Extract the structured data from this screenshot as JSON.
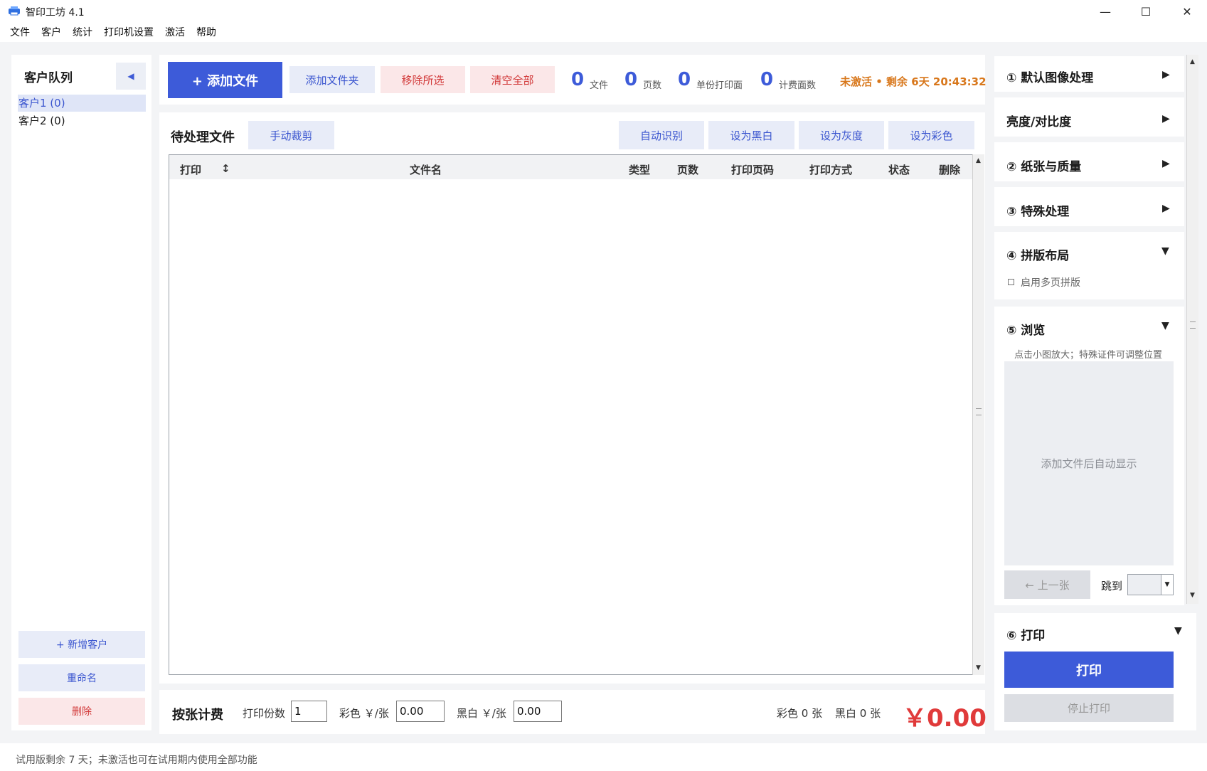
{
  "window": {
    "title": "智印工坊 4.1",
    "minimize_glyph": "—",
    "maximize_glyph": "☐",
    "close_glyph": "✕"
  },
  "menu": [
    "文件",
    "客户",
    "统计",
    "打印机设置",
    "激活",
    "帮助"
  ],
  "customers": {
    "title": "客户队列",
    "collapse_glyph": "◀",
    "items": [
      {
        "label": "客户1  (0)",
        "selected": true
      },
      {
        "label": "客户2  (0)",
        "selected": false
      }
    ],
    "add_label": "+  新增客户",
    "rename_label": "重命名",
    "delete_label": "删除"
  },
  "toolbar": {
    "add_file_label": "+  添加文件",
    "add_folder_label": "添加文件夹",
    "remove_selected_label": "移除所选",
    "clear_all_label": "清空全部",
    "stats": [
      {
        "value": "0",
        "label": "文件"
      },
      {
        "value": "0",
        "label": "页数"
      },
      {
        "value": "0",
        "label": "单份打印面"
      },
      {
        "value": "0",
        "label": "计费面数"
      }
    ],
    "activation_status": "未激活 • 剩余 6天 20:43:32"
  },
  "files": {
    "title": "待处理文件",
    "manual_crop_label": "手动裁剪",
    "auto_detect_label": "自动识别",
    "set_bw_label": "设为黑白",
    "set_gray_label": "设为灰度",
    "set_color_label": "设为彩色",
    "columns": [
      "打印",
      "↕",
      "文件名",
      "类型",
      "页数",
      "打印页码",
      "打印方式",
      "状态",
      "删除"
    ],
    "rows": []
  },
  "billing": {
    "title": "按张计费",
    "copies_label": "打印份数",
    "copies_value": "1",
    "color_price_label": "彩色 ￥/张",
    "color_price_value": "0.00",
    "bw_price_label": "黑白 ￥/张",
    "bw_price_value": "0.00",
    "color_count": "彩色 0 张",
    "bw_count": "黑白 0 张",
    "total": "￥0.00"
  },
  "settings": {
    "sec1_title": "① 默认图像处理",
    "sec2_title": "亮度/对比度",
    "sec3_title": "② 纸张与质量",
    "sec4_title": "③ 特殊处理",
    "sec5_title": "④ 拼版布局",
    "sec5_option": "启用多页拼版",
    "sec6_title": "⑤ 浏览",
    "sec6_hint": "点击小图放大；特殊证件可调整位置",
    "preview_placeholder": "添加文件后自动显示",
    "prev_label": "← 上一张",
    "jump_label": "跳到",
    "sec7_title": "⑥ 打印",
    "print_label": "打印",
    "stop_label": "停止打印",
    "collapsed_arrow": "▶",
    "expanded_arrow": "▼"
  },
  "status_bar": {
    "text": "试用版剩余 7 天；未激活也可在试用期内使用全部功能"
  }
}
